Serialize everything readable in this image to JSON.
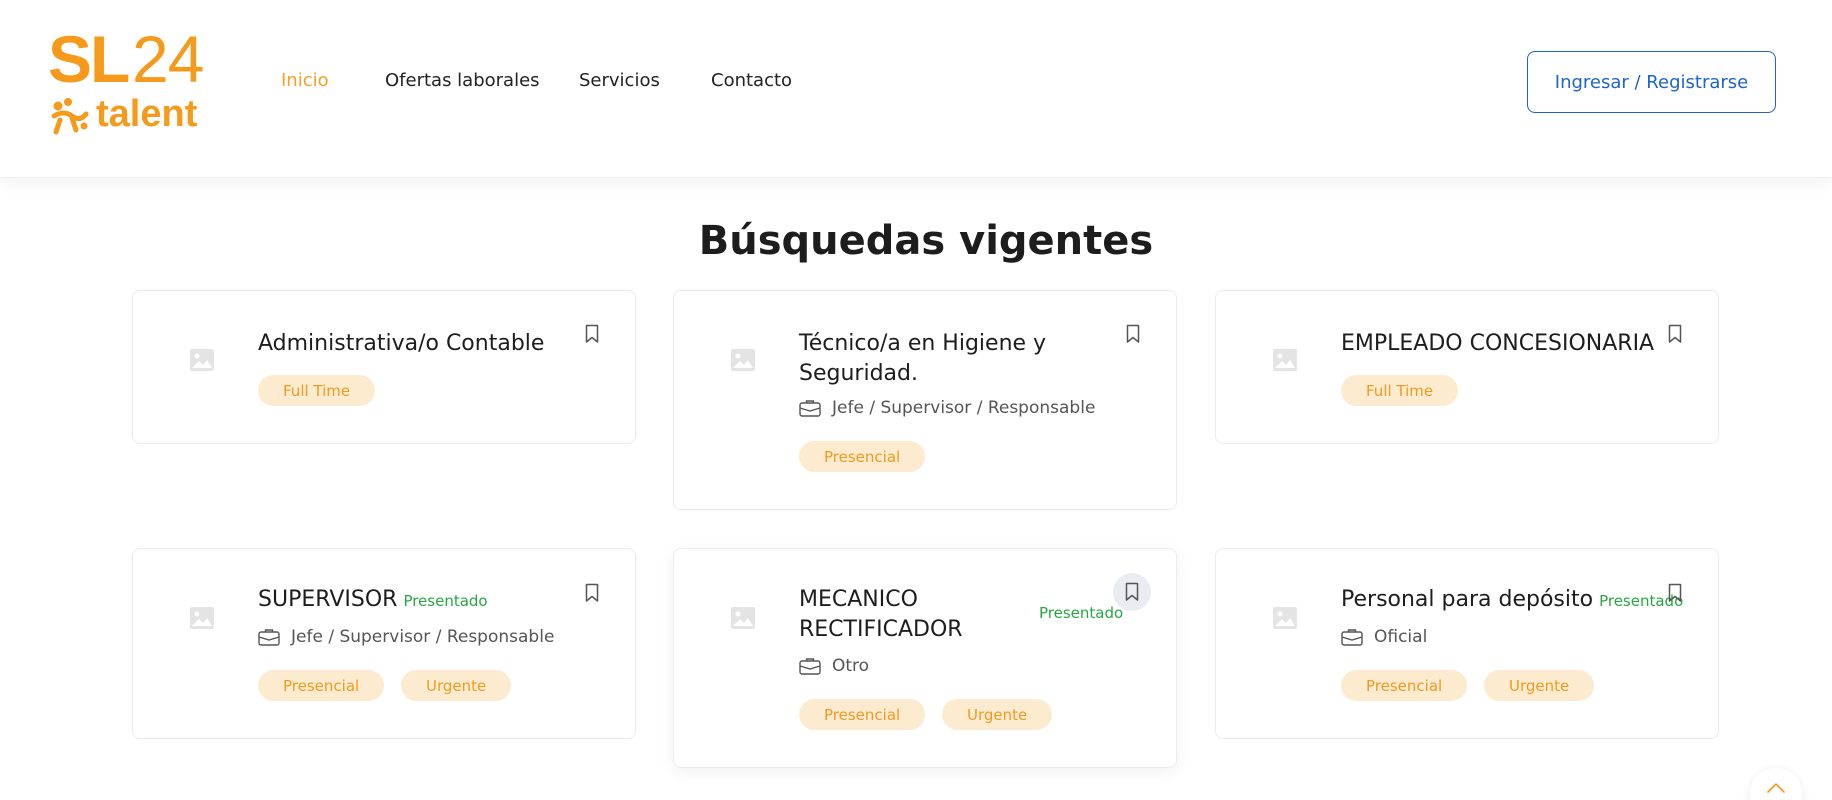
{
  "brand": {
    "logo_primary": "SL",
    "logo_number": "24",
    "logo_secondary": "talent",
    "color": "#f59a1b"
  },
  "nav": {
    "items": [
      {
        "label": "Inicio",
        "active": true
      },
      {
        "label": "Ofertas laborales",
        "active": false
      },
      {
        "label": "Servicios",
        "active": false
      },
      {
        "label": "Contacto",
        "active": false
      }
    ],
    "login_label": "Ingresar / Registrarse"
  },
  "section": {
    "title": "Búsquedas vigentes"
  },
  "jobs": [
    {
      "title": "Administrativa/o Contable",
      "presentado": "",
      "category": "",
      "tags": [
        "Full Time"
      ]
    },
    {
      "title": "Técnico/a en Higiene y Seguridad.",
      "presentado": "",
      "category": "Jefe / Supervisor / Responsable",
      "tags": [
        "Presencial"
      ]
    },
    {
      "title": "EMPLEADO CONCESIONARIA",
      "presentado": "",
      "category": "",
      "tags": [
        "Full Time"
      ]
    },
    {
      "title": "SUPERVISOR",
      "presentado": "Presentado",
      "category": "Jefe / Supervisor / Responsable",
      "tags": [
        "Presencial",
        "Urgente"
      ]
    },
    {
      "title": "MECANICO RECTIFICADOR",
      "presentado": "Presentado",
      "category": "Otro",
      "tags": [
        "Presencial",
        "Urgente"
      ]
    },
    {
      "title": "Personal para depósito",
      "presentado": "Presentado",
      "category": "Oficial",
      "tags": [
        "Presencial",
        "Urgente"
      ]
    }
  ],
  "colors": {
    "accent": "#f59a1b",
    "link": "#1f64c9",
    "tag_bg": "#fdebd0",
    "tag_text": "#f29a1f",
    "presentado": "#28a745"
  },
  "icons": {
    "bookmark": "bookmark-icon",
    "briefcase": "briefcase-icon",
    "image_placeholder": "image-placeholder-icon",
    "scroll_top": "chevron-up-icon"
  }
}
